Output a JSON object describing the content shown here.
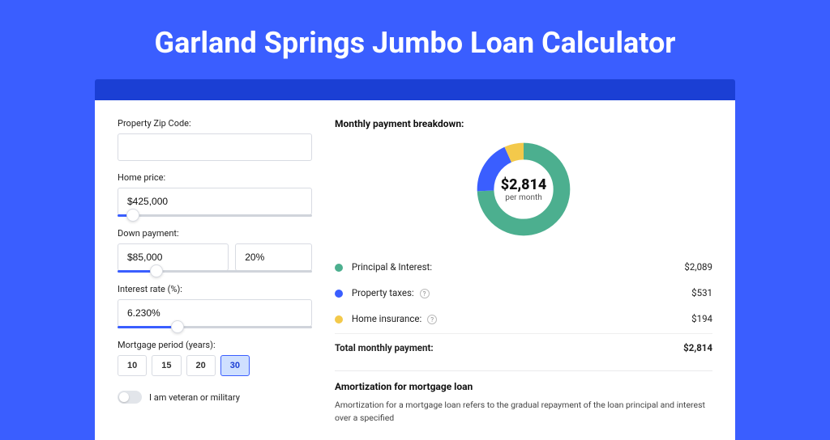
{
  "title": "Garland Springs Jumbo Loan Calculator",
  "form": {
    "zip_label": "Property Zip Code:",
    "zip_value": "",
    "home_price_label": "Home price:",
    "home_price_value": "$425,000",
    "down_payment_label": "Down payment:",
    "down_payment_amount": "$85,000",
    "down_payment_pct": "20%",
    "interest_label": "Interest rate (%):",
    "interest_value": "6.230%",
    "period_label": "Mortgage period (years):",
    "periods": [
      "10",
      "15",
      "20",
      "30"
    ],
    "period_selected": "30",
    "veteran_label": "I am veteran or military",
    "veteran_on": false
  },
  "breakdown": {
    "title": "Monthly payment breakdown:",
    "center_amount": "$2,814",
    "center_sub": "per month",
    "rows": [
      {
        "label": "Principal & Interest:",
        "value": "$2,089",
        "color": "green",
        "help": false
      },
      {
        "label": "Property taxes:",
        "value": "$531",
        "color": "blue",
        "help": true
      },
      {
        "label": "Home insurance:",
        "value": "$194",
        "color": "yellow",
        "help": true
      }
    ],
    "total_label": "Total monthly payment:",
    "total_value": "$2,814"
  },
  "amort": {
    "title": "Amortization for mortgage loan",
    "text": "Amortization for a mortgage loan refers to the gradual repayment of the loan principal and interest over a specified"
  },
  "chart_data": {
    "type": "pie",
    "title": "Monthly payment breakdown",
    "categories": [
      "Principal & Interest",
      "Property taxes",
      "Home insurance"
    ],
    "values": [
      2089,
      531,
      194
    ],
    "colors": [
      "#4caf8f",
      "#3a5eff",
      "#f3c94b"
    ],
    "total": 2814,
    "center_label": "$2,814 per month"
  }
}
